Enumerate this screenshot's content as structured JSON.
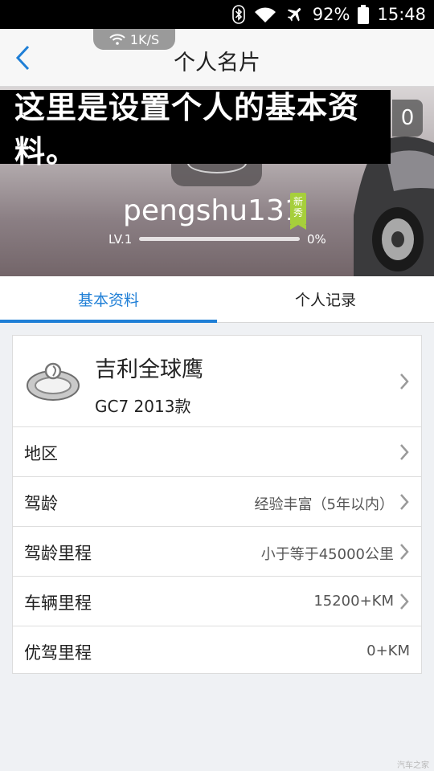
{
  "status_bar": {
    "battery": "92%",
    "time": "15:48",
    "icons": [
      "bluetooth-icon",
      "wifi-icon",
      "airplane-icon",
      "battery-icon"
    ]
  },
  "header": {
    "title": "个人名片",
    "speed": "1K/S"
  },
  "banner": {
    "caption": "这里是设置个人的基本资料。",
    "count": "0",
    "username": "pengshu131",
    "badge": "新秀",
    "level": "LV.1",
    "progress_percent": "0%",
    "progress_value": 0
  },
  "tabs": [
    {
      "label": "基本资料",
      "active": true
    },
    {
      "label": "个人记录",
      "active": false
    }
  ],
  "car": {
    "name": "吉利全球鹰",
    "model": "GC7 2013款"
  },
  "rows": [
    {
      "label": "地区",
      "value": ""
    },
    {
      "label": "驾龄",
      "value": "经验丰富（5年以内）"
    },
    {
      "label": "驾龄里程",
      "value": "小于等于45000公里"
    },
    {
      "label": "车辆里程",
      "value": "15200+KM"
    },
    {
      "label": "优驾里程",
      "value": "0+KM"
    }
  ],
  "watermark": "汽车之家",
  "colors": {
    "accent": "#1f7fd6",
    "badge": "#a6cf3b",
    "background": "#eff1f4"
  }
}
